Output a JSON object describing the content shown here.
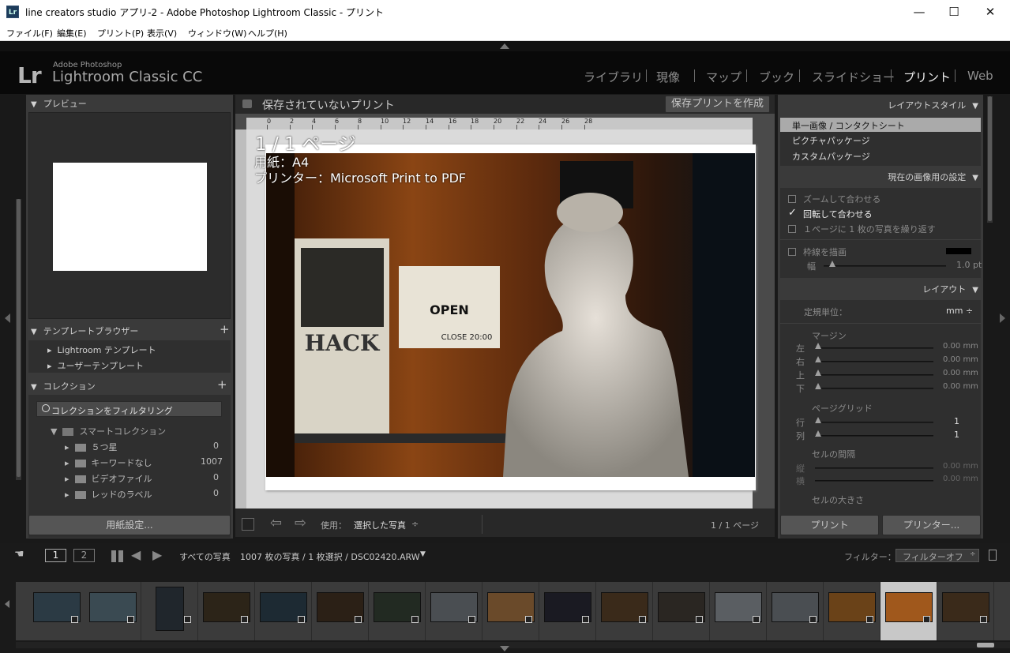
{
  "window": {
    "title": "line creators studio アプリ-2 - Adobe Photoshop Lightroom Classic - プリント",
    "app_icon": "Lr",
    "min": "—",
    "max": "☐",
    "close": "✕"
  },
  "menu": [
    "ファイル(F)",
    "編集(E)",
    "プリント(P)",
    "表示(V)",
    "ウィンドウ(W)",
    "ヘルプ(H)"
  ],
  "identity": {
    "logo": "Lr",
    "adobe": "Adobe Photoshop",
    "product": "Lightroom Classic CC"
  },
  "modules": [
    "ライブラリ",
    "現像",
    "マップ",
    "ブック",
    "スライドショー",
    "プリント",
    "Web"
  ],
  "active_module": "プリント",
  "left": {
    "preview_header": "プレビュー",
    "template_header": "テンプレートブラウザー",
    "templates": [
      "Lightroom テンプレート",
      "ユーザーテンプレート"
    ],
    "collection_header": "コレクション",
    "filter_label": "コレクションをフィルタリング",
    "smart_collection": "スマートコレクション",
    "smart_items": [
      {
        "label": "５つ星",
        "count": "0"
      },
      {
        "label": "キーワードなし",
        "count": "1007"
      },
      {
        "label": "ビデオファイル",
        "count": "0"
      },
      {
        "label": "レッドのラベル",
        "count": "0"
      }
    ],
    "page_setup_button": "用紙設定..."
  },
  "center": {
    "unsaved_label": "保存されていないプリント",
    "save_button": "保存プリントを作成",
    "ruler_ticks": [
      "0",
      "2",
      "4",
      "6",
      "8",
      "10",
      "12",
      "14",
      "16",
      "18",
      "20",
      "22",
      "24",
      "26",
      "28"
    ],
    "page_info": "1 / 1 ページ",
    "paper": "用紙：A4",
    "printer": "プリンター：Microsoft Print to PDF",
    "use_label": "使用：",
    "use_value": "選択した写真",
    "page_count": "1 / 1 ページ",
    "photo_text": {
      "open": "OPEN",
      "close": "CLOSE 20:00",
      "hack": "HACK"
    }
  },
  "right": {
    "layout_style_header": "レイアウトスタイル",
    "layout_styles": [
      "単一画像 / コンタクトシート",
      "ピクチャパッケージ",
      "カスタムパッケージ"
    ],
    "image_settings_header": "現在の画像用の設定",
    "zoom_fit": "ズームして合わせる",
    "rotate_fit": "回転して合わせる",
    "repeat_one": "１ページに 1 枚の写真を繰り返す",
    "stroke_border": "枠線を描画",
    "width_label": "幅",
    "width_value": "1.0 pt",
    "layout_header": "レイアウト",
    "ruler_units_label": "定規単位：",
    "ruler_units_value": "mm ÷",
    "margins_label": "マージン",
    "margins": [
      {
        "label": "左",
        "value": "0.00 mm"
      },
      {
        "label": "右",
        "value": "0.00 mm"
      },
      {
        "label": "上",
        "value": "0.00 mm"
      },
      {
        "label": "下",
        "value": "0.00 mm"
      }
    ],
    "page_grid_label": "ページグリッド",
    "page_grid": [
      {
        "label": "行",
        "value": "1"
      },
      {
        "label": "列",
        "value": "1"
      }
    ],
    "cell_spacing_label": "セルの間隔",
    "cell_spacing": [
      {
        "label": "縦",
        "value": "0.00 mm"
      },
      {
        "label": "横",
        "value": "0.00 mm"
      }
    ],
    "cell_size_label": "セルの大きさ",
    "print_button": "プリント",
    "printer_button": "プリンター..."
  },
  "filmstrip": {
    "page1": "1",
    "page2": "2",
    "source": "すべての写真",
    "count": "1007 枚の写真 / 1 枚選択 / DSC02420.ARW",
    "filter_label": "フィルター：",
    "filter_value": "フィルターオフ"
  }
}
